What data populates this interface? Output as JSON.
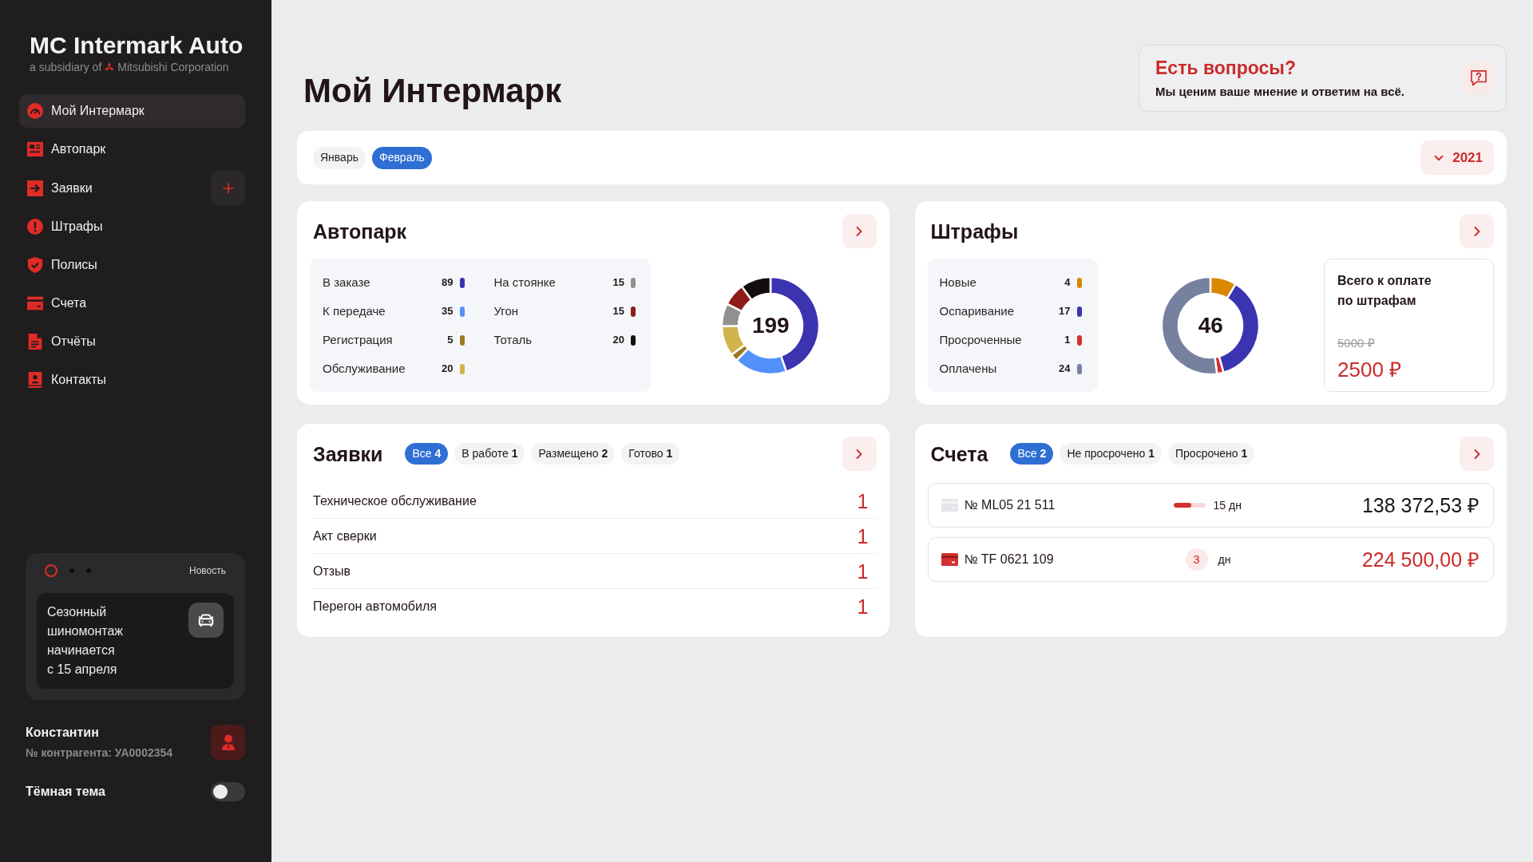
{
  "sidebar": {
    "logo": {
      "title": "MC Intermark Auto",
      "subtitle_prefix": "a subsidiary of",
      "subtitle_company": "Mitsubishi Corporation"
    },
    "items": [
      {
        "label": "Мой Интермарк",
        "selected": true,
        "add_button": false
      },
      {
        "label": "Автопарк",
        "selected": false,
        "add_button": false
      },
      {
        "label": "Заявки",
        "selected": false,
        "add_button": true
      },
      {
        "label": "Штрафы",
        "selected": false,
        "add_button": false
      },
      {
        "label": "Полисы",
        "selected": false,
        "add_button": false
      },
      {
        "label": "Счета",
        "selected": false,
        "add_button": false
      },
      {
        "label": "Отчёты",
        "selected": false,
        "add_button": false
      },
      {
        "label": "Контакты",
        "selected": false,
        "add_button": false
      }
    ],
    "news": {
      "label": "Новость",
      "pages": [
        {
          "selected": true
        },
        {
          "selected": false
        },
        {
          "selected": false
        }
      ],
      "text": "Сезонный\nшиномонтаж\nначинается\nс 15 апреля"
    },
    "user": {
      "name": "Константин",
      "account": "№ контрагента: УА0002354"
    },
    "dark_theme": {
      "label": "Тёмная тема",
      "on": false
    }
  },
  "header": {
    "title": "Мой Интермарк",
    "help": {
      "title": "Есть вопросы?",
      "text": "Мы ценим ваше мнение и ответим на всё."
    }
  },
  "period": {
    "months": [
      {
        "label": "Январь",
        "selected": false
      },
      {
        "label": "Февраль",
        "selected": true
      }
    ],
    "year": "2021"
  },
  "autopark": {
    "title": "Автопарк",
    "legend": [
      {
        "label": "В заказе",
        "value": "89",
        "color": "#3b33b0"
      },
      {
        "label": "К передаче",
        "value": "35",
        "color": "#5490fb"
      },
      {
        "label": "Регистрация",
        "value": "5",
        "color": "#9c781f"
      },
      {
        "label": "Обслуживание",
        "value": "20",
        "color": "#d2b24c"
      },
      {
        "label": "На стоянке",
        "value": "15",
        "color": "#928f8f"
      },
      {
        "label": "Угон",
        "value": "15",
        "color": "#8e1c18"
      },
      {
        "label": "Тоталь",
        "value": "20",
        "color": "#140d0d"
      }
    ],
    "total": "199",
    "chart_data": {
      "type": "donut",
      "values": [
        44.72,
        17.59,
        2.51,
        10.05,
        7.54,
        7.54,
        10.05
      ]
    }
  },
  "fines": {
    "title": "Штрафы",
    "legend": [
      {
        "label": "Новые",
        "value": "4",
        "color": "#d98800"
      },
      {
        "label": "Оспаривание",
        "value": "17",
        "color": "#3b34b1"
      },
      {
        "label": "Просроченные",
        "value": "1",
        "color": "#d3302f"
      },
      {
        "label": "Оплачены",
        "value": "24",
        "color": "#76809f"
      }
    ],
    "total": "46",
    "chart_data": {
      "type": "donut",
      "values": [
        8.7,
        36.96,
        2.17,
        52.17
      ]
    },
    "summary": {
      "title": "Всего к оплате по штрафам",
      "old_amount": "5000 ₽",
      "amount": "2500 ₽"
    }
  },
  "requests": {
    "title": "Заявки",
    "tabs": [
      {
        "label": "Все",
        "count": "4",
        "selected": true
      },
      {
        "label": "В работе",
        "count": "1",
        "selected": false
      },
      {
        "label": "Размещено",
        "count": "2",
        "selected": false
      },
      {
        "label": "Готово",
        "count": "1",
        "selected": false
      }
    ],
    "rows": [
      {
        "label": "Техническое обслуживание",
        "count": "1"
      },
      {
        "label": "Акт сверки",
        "count": "1"
      },
      {
        "label": "Отзыв",
        "count": "1"
      },
      {
        "label": "Перегон автомобиля",
        "count": "1"
      }
    ]
  },
  "invoices": {
    "title": "Счета",
    "tabs": [
      {
        "label": "Все",
        "count": "2",
        "selected": true
      },
      {
        "label": "Не просрочено",
        "count": "1",
        "selected": false
      },
      {
        "label": "Просрочено",
        "count": "1",
        "selected": false
      }
    ],
    "rows": [
      {
        "kind": "progress",
        "number": "№ ML05 21 511",
        "level": 0.55,
        "days": "15 дн",
        "amount": "138 372,53 ₽",
        "overdue": false
      },
      {
        "kind": "badge",
        "number": "№ TF 0621 109",
        "days_count": "3",
        "days_unit": "дн",
        "amount": "224 500,00 ₽",
        "overdue": true
      }
    ]
  }
}
